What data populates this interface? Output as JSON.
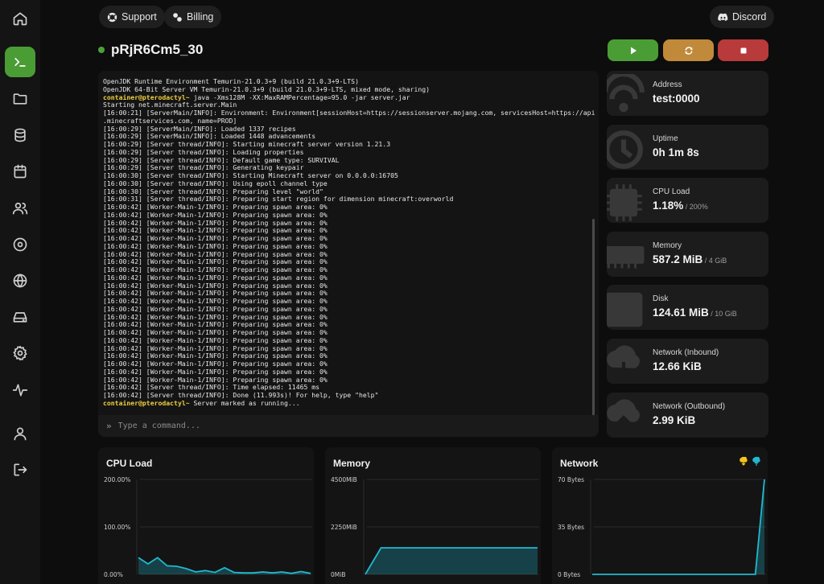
{
  "sidebar": {
    "items": [
      {
        "name": "home-icon",
        "active": false
      },
      {
        "name": "console-icon",
        "active": true
      },
      {
        "name": "folder-icon",
        "active": false
      },
      {
        "name": "database-icon",
        "active": false
      },
      {
        "name": "calendar-icon",
        "active": false
      },
      {
        "name": "users-icon",
        "active": false
      },
      {
        "name": "disc-icon",
        "active": false
      },
      {
        "name": "globe-icon",
        "active": false
      },
      {
        "name": "drive-icon",
        "active": false
      },
      {
        "name": "gear-icon",
        "active": false
      },
      {
        "name": "activity-icon",
        "active": false
      },
      {
        "name": "account-icon",
        "active": false
      },
      {
        "name": "logout-icon",
        "active": false
      }
    ]
  },
  "header": {
    "support_label": "Support",
    "billing_label": "Billing",
    "discord_label": "Discord"
  },
  "server": {
    "name": "pRjR6Cm5_30",
    "status_color": "#4aa13a"
  },
  "controls": {
    "start_color": "#4a9d35",
    "restart_color": "#c08a3a",
    "stop_color": "#b83a3a"
  },
  "console": {
    "lines": [
      "OpenJDK Runtime Environment Temurin-21.0.3+9 (build 21.0.3+9-LTS)",
      "OpenJDK 64-Bit Server VM Temurin-21.0.3+9 (build 21.0.3+9-LTS, mixed mode, sharing)",
      "container@pterodactyl~ java -Xms128M -XX:MaxRAMPercentage=95.0 -jar server.jar",
      "Starting net.minecraft.server.Main",
      "[16:00:21] [ServerMain/INFO]: Environment: Environment[sessionHost=https://sessionserver.mojang.com, servicesHost=https://api",
      ".minecraftservices.com, name=PROD]",
      "[16:00:29] [ServerMain/INFO]: Loaded 1337 recipes",
      "[16:00:29] [ServerMain/INFO]: Loaded 1448 advancements",
      "[16:00:29] [Server thread/INFO]: Starting minecraft server version 1.21.3",
      "[16:00:29] [Server thread/INFO]: Loading properties",
      "[16:00:29] [Server thread/INFO]: Default game type: SURVIVAL",
      "[16:00:29] [Server thread/INFO]: Generating keypair",
      "[16:00:30] [Server thread/INFO]: Starting Minecraft server on 0.0.0.0:16705",
      "[16:00:30] [Server thread/INFO]: Using epoll channel type",
      "[16:00:30] [Server thread/INFO]: Preparing level \"world\"",
      "[16:00:31] [Server thread/INFO]: Preparing start region for dimension minecraft:overworld",
      "[16:00:42] [Worker-Main-1/INFO]: Preparing spawn area: 0%",
      "[16:00:42] [Worker-Main-1/INFO]: Preparing spawn area: 0%",
      "[16:00:42] [Worker-Main-1/INFO]: Preparing spawn area: 0%",
      "[16:00:42] [Worker-Main-1/INFO]: Preparing spawn area: 0%",
      "[16:00:42] [Worker-Main-1/INFO]: Preparing spawn area: 0%",
      "[16:00:42] [Worker-Main-1/INFO]: Preparing spawn area: 0%",
      "[16:00:42] [Worker-Main-1/INFO]: Preparing spawn area: 0%",
      "[16:00:42] [Worker-Main-1/INFO]: Preparing spawn area: 0%",
      "[16:00:42] [Worker-Main-1/INFO]: Preparing spawn area: 0%",
      "[16:00:42] [Worker-Main-1/INFO]: Preparing spawn area: 0%",
      "[16:00:42] [Worker-Main-1/INFO]: Preparing spawn area: 0%",
      "[16:00:42] [Worker-Main-1/INFO]: Preparing spawn area: 0%",
      "[16:00:42] [Worker-Main-1/INFO]: Preparing spawn area: 0%",
      "[16:00:42] [Worker-Main-1/INFO]: Preparing spawn area: 0%",
      "[16:00:42] [Worker-Main-1/INFO]: Preparing spawn area: 0%",
      "[16:00:42] [Worker-Main-1/INFO]: Preparing spawn area: 0%",
      "[16:00:42] [Worker-Main-1/INFO]: Preparing spawn area: 0%",
      "[16:00:42] [Worker-Main-1/INFO]: Preparing spawn area: 0%",
      "[16:00:42] [Worker-Main-1/INFO]: Preparing spawn area: 0%",
      "[16:00:42] [Worker-Main-1/INFO]: Preparing spawn area: 0%",
      "[16:00:42] [Worker-Main-1/INFO]: Preparing spawn area: 0%",
      "[16:00:42] [Worker-Main-1/INFO]: Preparing spawn area: 0%",
      "[16:00:42] [Worker-Main-1/INFO]: Preparing spawn area: 0%",
      "[16:00:42] [Server thread/INFO]: Time elapsed: 11465 ms",
      "[16:00:42] [Server thread/INFO]: Done (11.993s)! For help, type \"help\"",
      "container@pterodactyl~ Server marked as running..."
    ],
    "prompt": "container@pterodactyl~",
    "input_placeholder": "Type a command..."
  },
  "stats": [
    {
      "label": "Address",
      "value": "test:0000",
      "sub": "",
      "icon": "wifi-icon"
    },
    {
      "label": "Uptime",
      "value": "0h 1m 8s",
      "sub": "",
      "icon": "clock-icon"
    },
    {
      "label": "CPU Load",
      "value": "1.18%",
      "sub": " / 200%",
      "icon": "cpu-icon"
    },
    {
      "label": "Memory",
      "value": "587.2 MiB",
      "sub": " / 4 GiB",
      "icon": "memory-icon"
    },
    {
      "label": "Disk",
      "value": "124.61 MiB",
      "sub": " / 10 GiB",
      "icon": "disk-icon"
    },
    {
      "label": "Network (Inbound)",
      "value": "12.66 KiB",
      "sub": "",
      "icon": "cloud-download-icon"
    },
    {
      "label": "Network (Outbound)",
      "value": "2.99 KiB",
      "sub": "",
      "icon": "cloud-upload-icon"
    }
  ],
  "graphs": {
    "cpu": {
      "title": "CPU Load",
      "ticks": [
        "200.00%",
        "100.00%",
        "0.00%"
      ],
      "ymax": 200,
      "values": [
        35,
        22,
        35,
        18,
        17,
        12,
        5,
        8,
        4,
        14,
        4,
        3,
        3,
        5,
        3,
        5,
        2,
        6,
        2
      ],
      "color": "#22b8cf"
    },
    "memory": {
      "title": "Memory",
      "ticks": [
        "4500MiB",
        "2250MiB",
        "0MiB"
      ],
      "ymax": 4500,
      "values": [
        0,
        1260,
        1260,
        1260,
        1260,
        1260,
        1260,
        1260,
        1260,
        1260,
        1260,
        1260
      ],
      "color": "#22b8cf"
    },
    "network": {
      "title": "Network",
      "ticks": [
        "70 Bytes",
        "35 Bytes",
        "0 Bytes"
      ],
      "ymax": 70,
      "values": [
        0,
        0,
        0,
        0,
        0,
        0,
        0,
        0,
        0,
        0,
        0,
        0,
        0,
        0,
        0,
        0,
        0,
        0,
        0,
        70
      ],
      "color": "#22b8cf",
      "legend_icons": [
        "cloud-download-icon",
        "cloud-upload-icon"
      ],
      "legend_colors": [
        "#f5c518",
        "#22b8cf"
      ]
    }
  }
}
